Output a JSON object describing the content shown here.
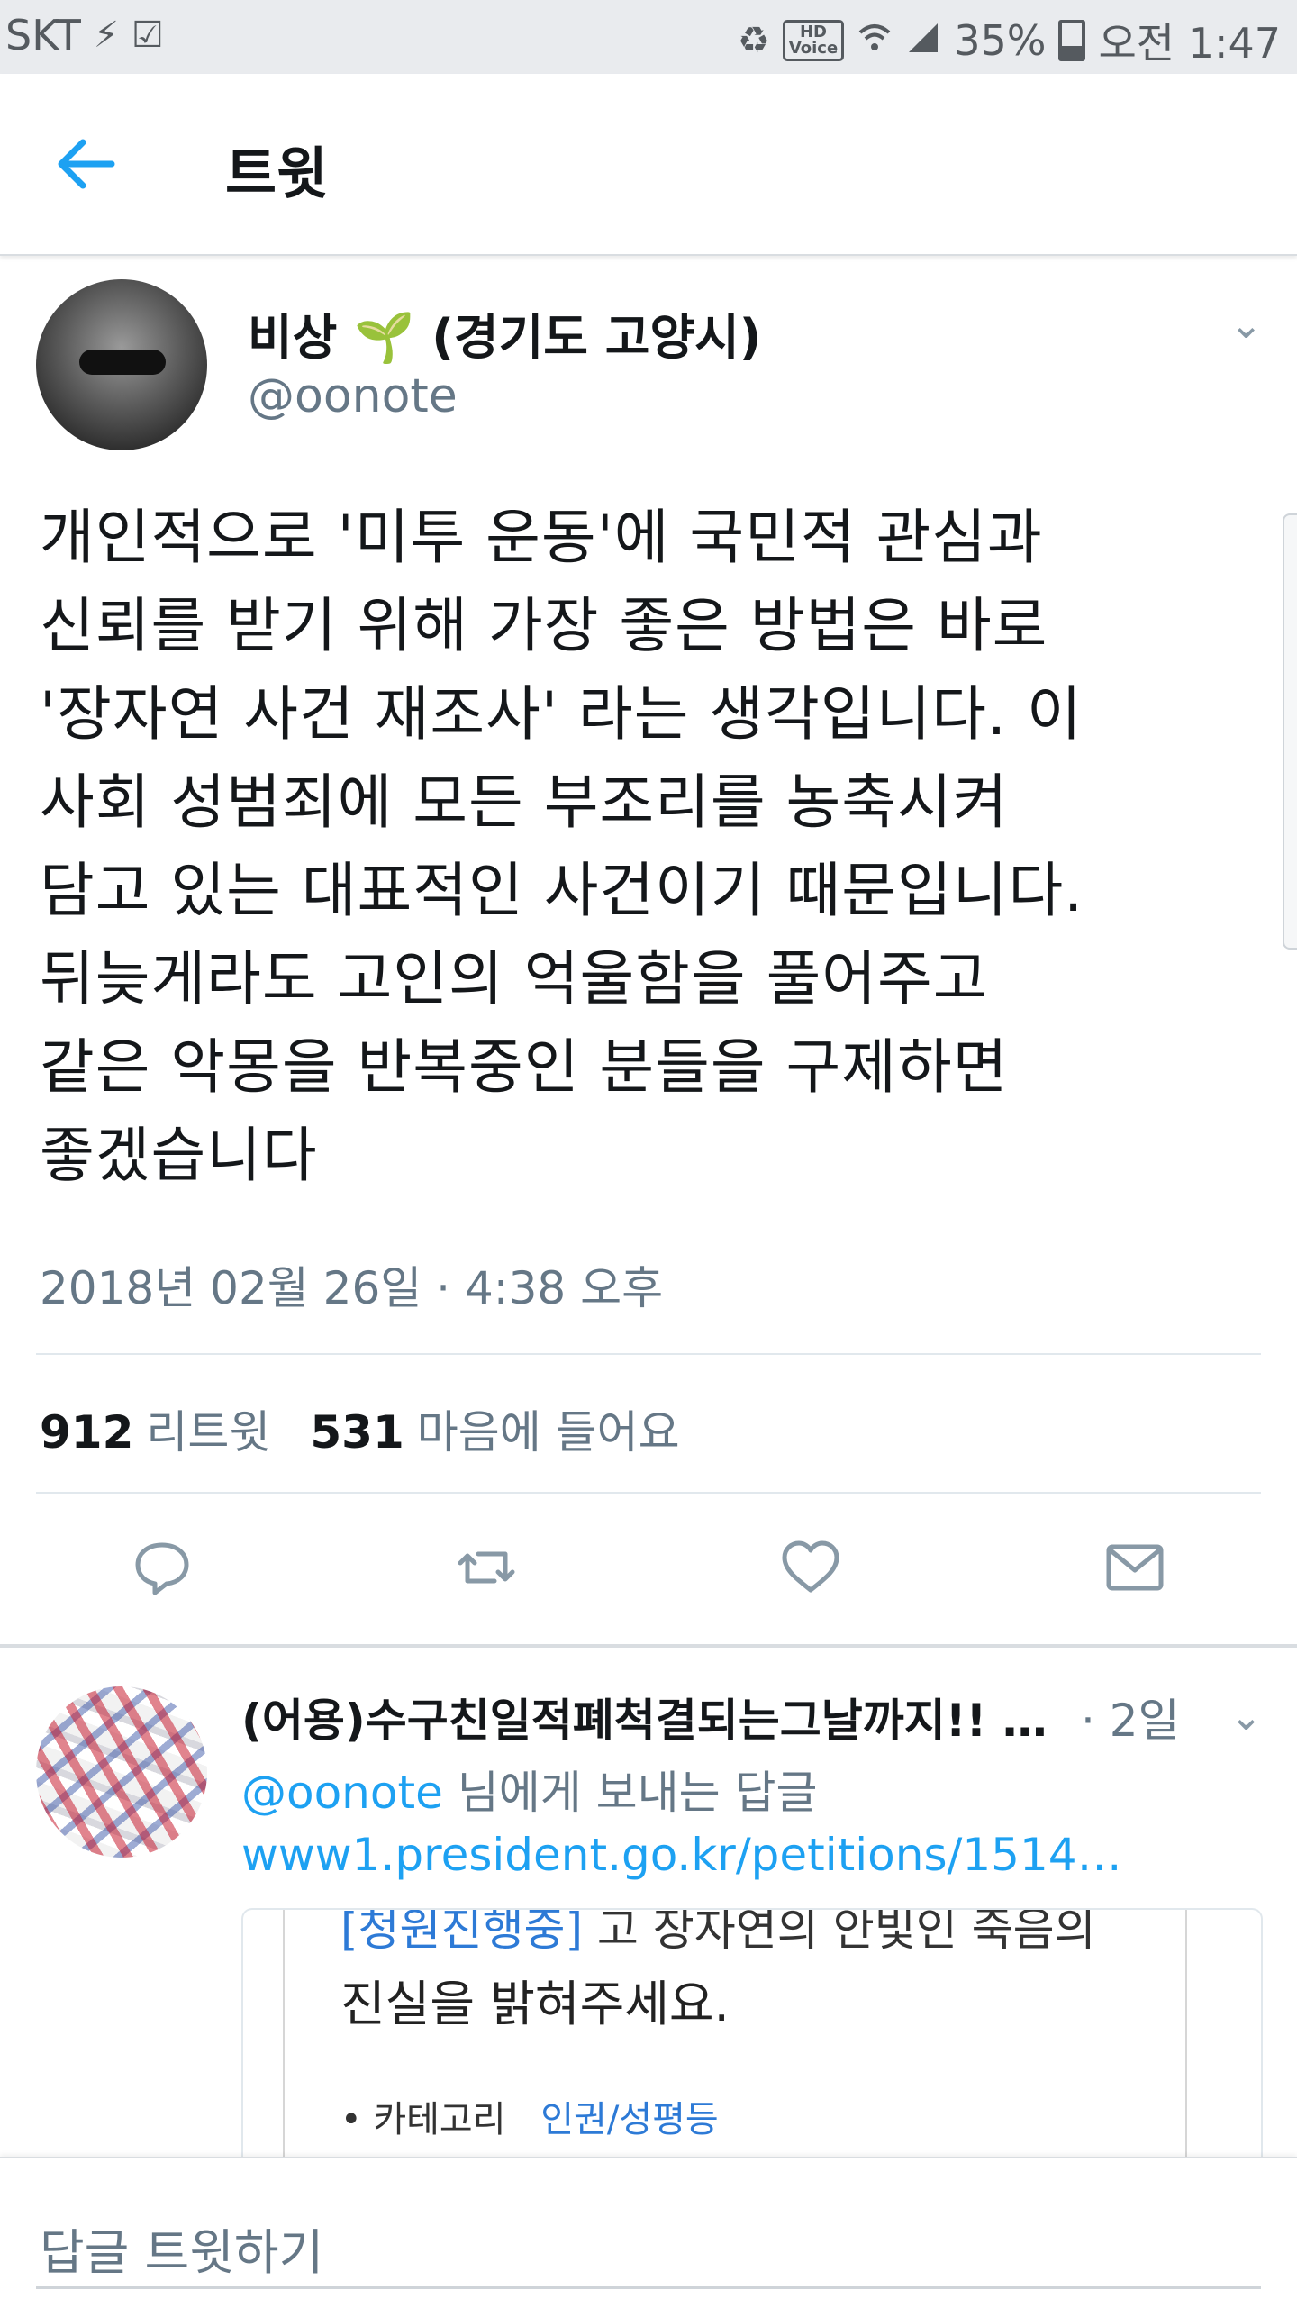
{
  "status_bar": {
    "carrier": "SKT",
    "hd_voice": "HD\nVoice",
    "battery": "35%",
    "time": "오전 1:47"
  },
  "header": {
    "title": "트윗",
    "back_icon": "arrow-left-icon"
  },
  "tweet": {
    "author_name": "비상",
    "author_emoji": "🌱",
    "author_location": "(경기도 고양시)",
    "handle": "@oonote",
    "text": "개인적으로 '미투 운동'에 국민적 관심과\n신뢰를 받기 위해 가장 좋은 방법은 바로\n'장자연 사건 재조사' 라는 생각입니다. 이\n사회 성범죄에 모든 부조리를 농축시켜\n담고 있는 대표적인 사건이기 때문입니다.\n뒤늦게라도 고인의 억울함을 풀어주고\n같은 악몽을 반복중인 분들을 구제하면\n좋겠습니다",
    "timestamp": "2018년 02월 26일 · 4:38 오후",
    "retweet_count": "912",
    "retweet_label": "리트윗",
    "like_count": "531",
    "like_label": "마음에 들어요"
  },
  "actions": [
    "reply-icon",
    "retweet-icon",
    "like-icon",
    "message-icon"
  ],
  "reply": {
    "author_name": "(어용)수구친일적폐척결되는그날까지!! …",
    "time": "· 2일",
    "to_mention": "@oonote",
    "to_suffix": " 님에게 보내는 답글",
    "link": "www1.president.go.kr/petitions/1514…",
    "card": {
      "cut_prefix": "[청원진행중]",
      "cut_rest": " 고 장자연의 안빛인 죽음의",
      "title": "진실을 밝혀주세요.",
      "category_label": "카테고리",
      "category_value": "인권/성평등"
    }
  },
  "compose": {
    "placeholder": "답글 트윗하기"
  },
  "colors": {
    "accent": "#1da1f2",
    "secondary_text": "#657786",
    "primary_text": "#14171a"
  }
}
